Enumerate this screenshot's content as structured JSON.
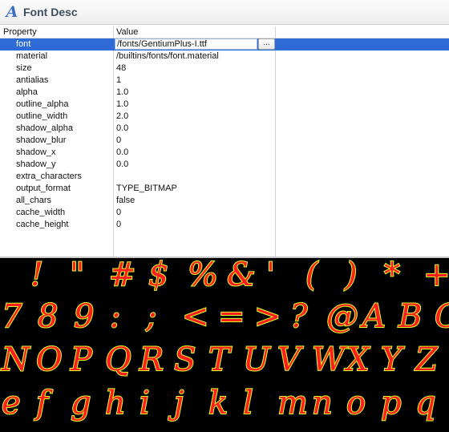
{
  "window": {
    "title": "Font Desc",
    "icon": "font-icon"
  },
  "table": {
    "headers": {
      "property": "Property",
      "value": "Value"
    },
    "rows": [
      {
        "name": "font",
        "value": "/fonts/GentiumPlus-I.ttf",
        "selected": true,
        "button": "..."
      },
      {
        "name": "material",
        "value": "/builtins/fonts/font.material"
      },
      {
        "name": "size",
        "value": "48"
      },
      {
        "name": "antialias",
        "value": "1"
      },
      {
        "name": "alpha",
        "value": "1.0"
      },
      {
        "name": "outline_alpha",
        "value": "1.0"
      },
      {
        "name": "outline_width",
        "value": "2.0"
      },
      {
        "name": "shadow_alpha",
        "value": "0.0"
      },
      {
        "name": "shadow_blur",
        "value": "0"
      },
      {
        "name": "shadow_x",
        "value": "0.0"
      },
      {
        "name": "shadow_y",
        "value": "0.0"
      },
      {
        "name": "extra_characters",
        "value": ""
      },
      {
        "name": "output_format",
        "value": "TYPE_BITMAP"
      },
      {
        "name": "all_chars",
        "value": "false"
      },
      {
        "name": "cache_width",
        "value": "0"
      },
      {
        "name": "cache_height",
        "value": "0"
      }
    ]
  },
  "preview": {
    "lines": [
      [
        "!",
        "\"",
        "#",
        "$",
        "%",
        "&",
        "'",
        "(",
        ")",
        "*",
        "+",
        ","
      ],
      [
        "7",
        "8",
        "9",
        ":",
        ";",
        "<",
        "=",
        ">",
        "?",
        "@",
        "A",
        "B",
        "C"
      ],
      [
        "N",
        "O",
        "P",
        "Q",
        "R",
        "S",
        "T",
        "U",
        "V",
        "W",
        "X",
        "Y",
        "Z"
      ],
      [
        "e",
        "f",
        "g",
        "h",
        "i",
        "j",
        "k",
        "l",
        "m",
        "n",
        "o",
        "p",
        "q"
      ]
    ],
    "fill_color": "#ff1e1e",
    "outline_color": "#d6ff2a",
    "background": "#000000"
  }
}
